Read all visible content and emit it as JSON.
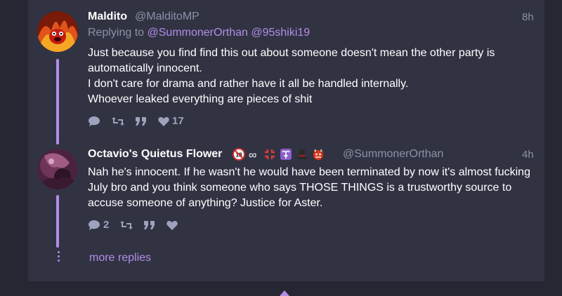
{
  "posts": [
    {
      "display_name": "Maldito",
      "handle": "@MalditoMP",
      "time": "8h",
      "replying_prefix": "Replying to",
      "replying_to": [
        "@SummonerOrthan",
        "@95shiki19"
      ],
      "lines": [
        "Just because you find find this out about someone doesn't mean the other party is automatically innocent.",
        "I don't care for drama and rather have it all be handled internally.",
        "Whoever leaked everything are pieces of shit"
      ],
      "like_count": "17"
    },
    {
      "display_name": "Octavio's Quietus Flower",
      "name_suffix": "∞",
      "handle": "@SummonerOrthan",
      "time": "4h",
      "text": "Nah he's innocent. If he wasn't he would have been terminated by now it's almost fucking July bro and you think someone who says THOSE THINGS is a trustworthy source to accuse someone of anything? Justice for Aster.",
      "reply_count": "2"
    }
  ],
  "more_replies": "more replies",
  "colors": {
    "accent": "#b38de6",
    "card": "#313343",
    "background": "#262733",
    "muted": "#8d91a8"
  },
  "icons": [
    "reply-icon",
    "retweet-icon",
    "quote-icon",
    "heart-icon"
  ]
}
